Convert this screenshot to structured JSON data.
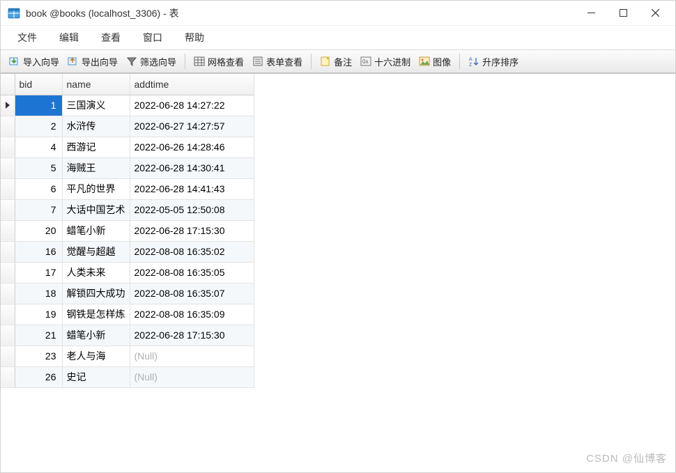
{
  "window": {
    "title": "book @books (localhost_3306) - 表"
  },
  "menu": {
    "file": "文件",
    "edit": "编辑",
    "view": "查看",
    "window": "窗口",
    "help": "帮助"
  },
  "toolbar": {
    "import_wizard": "导入向导",
    "export_wizard": "导出向导",
    "filter_wizard": "筛选向导",
    "grid_view": "网格查看",
    "form_view": "表单查看",
    "memo": "备注",
    "hex": "十六进制",
    "image": "图像",
    "sort_asc": "升序排序"
  },
  "columns": {
    "bid": "bid",
    "name": "name",
    "addtime": "addtime"
  },
  "null_label": "(Null)",
  "rows": [
    {
      "bid": "1",
      "name": "三国演义",
      "addtime": "2022-06-28 14:27:22",
      "selected": true
    },
    {
      "bid": "2",
      "name": "水浒传",
      "addtime": "2022-06-27 14:27:57"
    },
    {
      "bid": "4",
      "name": "西游记",
      "addtime": "2022-06-26 14:28:46"
    },
    {
      "bid": "5",
      "name": "海贼王",
      "addtime": "2022-06-28 14:30:41"
    },
    {
      "bid": "6",
      "name": "平凡的世界",
      "addtime": "2022-06-28 14:41:43"
    },
    {
      "bid": "7",
      "name": "大话中国艺术",
      "addtime": "2022-05-05 12:50:08"
    },
    {
      "bid": "20",
      "name": "蜡笔小新",
      "addtime": "2022-06-28 17:15:30"
    },
    {
      "bid": "16",
      "name": "觉醒与超越",
      "addtime": "2022-08-08 16:35:02"
    },
    {
      "bid": "17",
      "name": "人类未来",
      "addtime": "2022-08-08 16:35:05"
    },
    {
      "bid": "18",
      "name": "解锁四大成功",
      "addtime": "2022-08-08 16:35:07"
    },
    {
      "bid": "19",
      "name": "钢铁是怎样炼",
      "addtime": "2022-08-08 16:35:09"
    },
    {
      "bid": "21",
      "name": "蜡笔小新",
      "addtime": "2022-06-28 17:15:30"
    },
    {
      "bid": "23",
      "name": "老人与海",
      "addtime": null
    },
    {
      "bid": "26",
      "name": "史记",
      "addtime": null
    }
  ],
  "watermark": "CSDN @仙博客"
}
